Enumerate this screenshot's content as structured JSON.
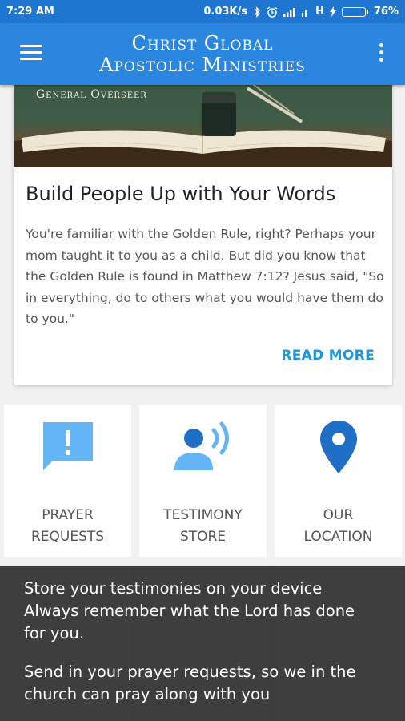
{
  "status_bar": {
    "time": "7:29 AM",
    "network_speed": "0.03K/s",
    "network_type": "H",
    "battery_percent": "76%",
    "battery_level": 0.76,
    "icons": [
      "bluetooth-icon",
      "alarm-icon",
      "signal-icon",
      "signal-icon",
      "charging-icon",
      "battery-icon"
    ]
  },
  "app_bar": {
    "title_line1": "Christ Global",
    "title_line2": "Apostolic Ministries",
    "menu_icon": "hamburger-menu-icon",
    "overflow_icon": "overflow-menu-icon"
  },
  "featured_card": {
    "image_caption": "General Overseer",
    "title": "Build People Up with Your Words",
    "body": "You're familiar with the Golden Rule, right? Perhaps your mom taught it to you as a child. But did you know that the Golden Rule is found in Matthew 7:12? Jesus said, \"So in everything, do to others what you would have them do to you.\"",
    "read_more": "READ MORE"
  },
  "tiles": [
    {
      "line1": "PRAYER",
      "line2": "REQUESTS",
      "icon": "prayer-request-icon"
    },
    {
      "line1": "TESTIMONY",
      "line2": "STORE",
      "icon": "testimony-speaker-icon"
    },
    {
      "line1": "OUR",
      "line2": "LOCATION",
      "icon": "location-pin-icon"
    }
  ],
  "toast": {
    "paragraph1": "Store your testimonies on your device Always remember what the Lord has done for you.",
    "paragraph2": "Send in your prayer requests, so we in the church can pray along with you"
  },
  "colors": {
    "primary": "#2a86de",
    "status_bar": "#1f76d0",
    "accent": "#2196d6",
    "icon_light_blue": "#64b5f6",
    "icon_dark_blue": "#1e6fc5"
  }
}
